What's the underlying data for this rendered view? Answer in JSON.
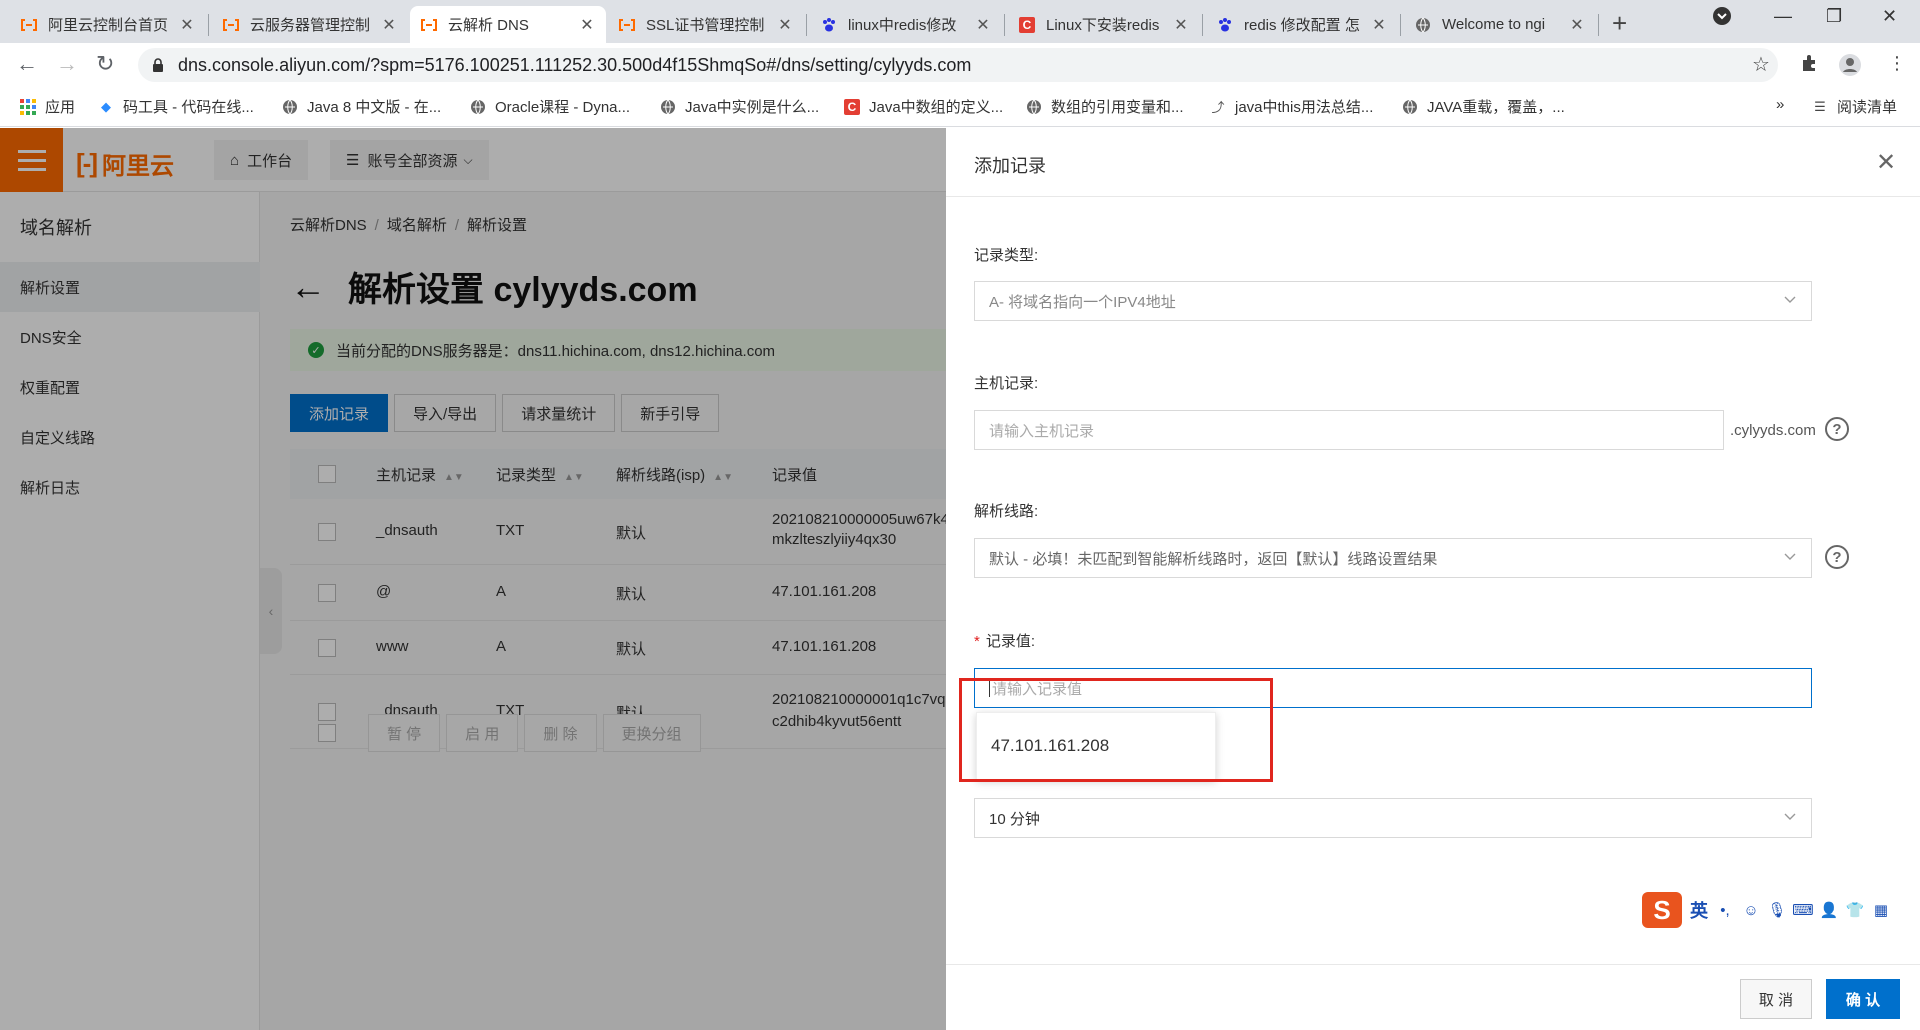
{
  "browser": {
    "tabs": [
      {
        "title": "阿里云控制台首页",
        "icon": "aliyun-icon"
      },
      {
        "title": "云服务器管理控制",
        "icon": "aliyun-icon"
      },
      {
        "title": "云解析 DNS",
        "icon": "aliyun-icon",
        "active": true
      },
      {
        "title": "SSL证书管理控制",
        "icon": "aliyun-icon"
      },
      {
        "title": "linux中redis修改",
        "icon": "baidu-icon"
      },
      {
        "title": "Linux下安装redis",
        "icon": "csdn-icon"
      },
      {
        "title": "redis 修改配置 怎",
        "icon": "baidu-icon"
      },
      {
        "title": "Welcome to ngi",
        "icon": "globe-icon"
      }
    ],
    "url": "dns.console.aliyun.com/?spm=5176.100251.111252.30.500d4f15ShmqSo#/dns/setting/cylyyds.com",
    "bookmarks": [
      "应用",
      "码工具 - 代码在线...",
      "Java 8 中文版 - 在...",
      "Oracle课程 - Dyna...",
      "Java中实例是什么...",
      "Java中数组的定义...",
      "数组的引用变量和...",
      "java中this用法总结...",
      "JAVA重载，覆盖，..."
    ],
    "reading_list": "阅读清单",
    "overflow": "»"
  },
  "console": {
    "logo": "阿里云",
    "workbench": "工作台",
    "resources": "账号全部资源",
    "sidebar": {
      "title": "域名解析",
      "items": [
        "解析设置",
        "DNS安全",
        "权重配置",
        "自定义线路",
        "解析日志"
      ]
    },
    "breadcrumb": [
      "云解析DNS",
      "域名解析",
      "解析设置"
    ],
    "page_title": "解析设置 cylyyds.com",
    "notice": "当前分配的DNS服务器是：dns11.hichina.com, dns12.hichina.com",
    "buttons": [
      "添加记录",
      "导入/导出",
      "请求量统计",
      "新手引导"
    ],
    "table": {
      "headers": [
        "主机记录",
        "记录类型",
        "解析线路(isp)",
        "记录值"
      ],
      "rows": [
        {
          "host": "_dnsauth",
          "type": "TXT",
          "line": "默认",
          "value": "202108210000005uw67k4",
          "value2": "mkzlteszlyiiy4qx30"
        },
        {
          "host": "@",
          "type": "A",
          "line": "默认",
          "value": "47.101.161.208",
          "value2": ""
        },
        {
          "host": "www",
          "type": "A",
          "line": "默认",
          "value": "47.101.161.208",
          "value2": ""
        },
        {
          "host": "_dnsauth",
          "type": "TXT",
          "line": "默认",
          "value": "202108210000001q1c7vq",
          "value2": "c2dhib4kyvut56entt"
        }
      ]
    },
    "footer_buttons": [
      "暂 停",
      "启 用",
      "删 除",
      "更换分组"
    ]
  },
  "drawer": {
    "title": "添加记录",
    "record_type_label": "记录类型:",
    "record_type_value": "A- 将域名指向一个IPV4地址",
    "host_label": "主机记录:",
    "host_placeholder": "请输入主机记录",
    "host_suffix": ".cylyyds.com",
    "line_label": "解析线路:",
    "line_value": "默认 - 必填！未匹配到智能解析线路时，返回【默认】线路设置结果",
    "value_label": "记录值:",
    "value_required": "*",
    "value_placeholder": "请输入记录值",
    "autocomplete": "47.101.161.208",
    "ttl_value": "10 分钟",
    "cancel": "取 消",
    "confirm": "确 认"
  },
  "ime": {
    "lang": "英",
    "punct": "•,"
  },
  "colors": {
    "brand": "#ff6a00",
    "primary": "#0070cc",
    "highlight": "#e0261e"
  }
}
